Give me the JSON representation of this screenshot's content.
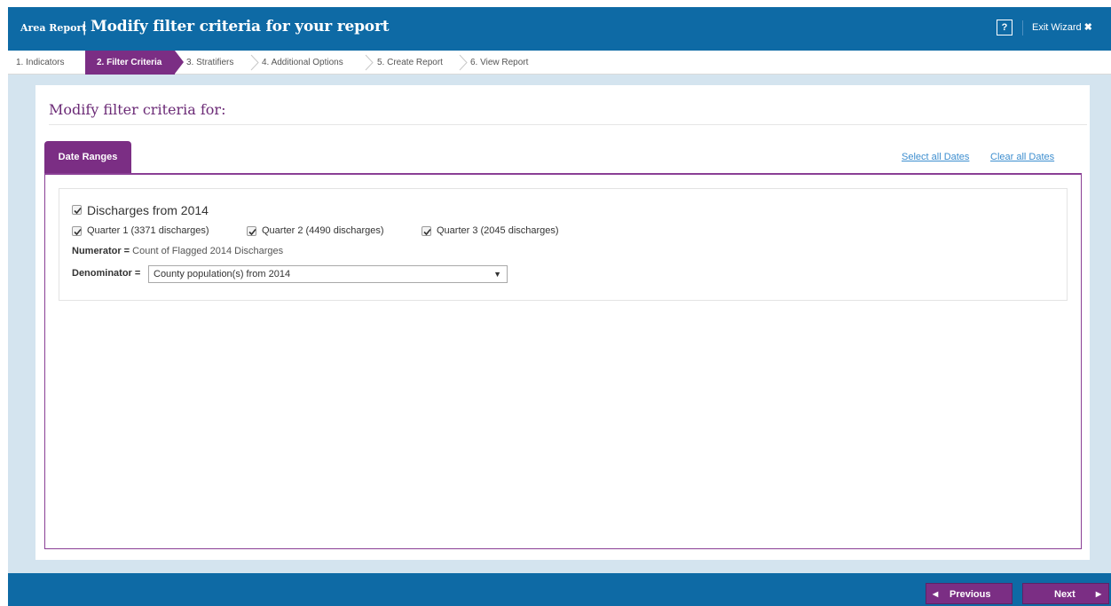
{
  "header": {
    "subtitle": "Area Report",
    "separator": "|",
    "title": "Modify filter criteria for your report",
    "help_label": "?",
    "exit_label": "Exit Wizard",
    "exit_icon": "✖"
  },
  "steps": [
    {
      "label": "1. Indicators"
    },
    {
      "label": "2. Filter Criteria"
    },
    {
      "label": "3. Stratifiers"
    },
    {
      "label": "4. Additional Options"
    },
    {
      "label": "5. Create Report"
    },
    {
      "label": "6. View Report"
    }
  ],
  "main": {
    "heading": "Modify filter criteria for:",
    "tab_label": "Date Ranges",
    "select_all_label": "Select all Dates",
    "clear_all_label": "Clear all Dates",
    "group": {
      "label": "Discharges from 2014",
      "checked": true,
      "quarters": [
        {
          "label": "Quarter 1 (3371 discharges)",
          "checked": true
        },
        {
          "label": "Quarter 2 (4490 discharges)",
          "checked": true
        },
        {
          "label": "Quarter 3 (2045 discharges)",
          "checked": true
        }
      ],
      "numerator_key": "Numerator =",
      "numerator_value": "Count of Flagged 2014 Discharges",
      "denominator_key": "Denominator =",
      "denominator_value": "County population(s) from 2014"
    }
  },
  "footer": {
    "previous_label": "Previous",
    "next_label": "Next"
  },
  "colors": {
    "header_blue": "#0e6aa5",
    "accent_purple": "#7b2e84",
    "link_blue": "#3d8ecf",
    "background": "#d4e4ef"
  }
}
